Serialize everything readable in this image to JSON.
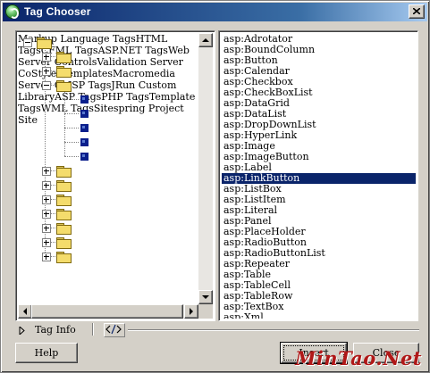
{
  "window": {
    "title": "Tag Chooser"
  },
  "tree": {
    "root": "Markup Language Tags",
    "folders_before": [
      "HTML Tags",
      "CFML Tags"
    ],
    "aspnet": {
      "label": "ASP.NET Tags",
      "children": [
        "Web Server Controls",
        "Validation Server Co",
        "Styles",
        "Templates",
        "Macromedia Server Co"
      ],
      "selected_child": "Web Server Controls"
    },
    "folders_after": [
      "JSP Tags",
      "JRun Custom Library",
      "ASP Tags",
      "PHP Tags",
      "Template Tags",
      "WML Tags",
      "Sitespring Project Site"
    ]
  },
  "list": {
    "items": [
      "asp:Adrotator",
      "asp:BoundColumn",
      "asp:Button",
      "asp:Calendar",
      "asp:Checkbox",
      "asp:CheckBoxList",
      "asp:DataGrid",
      "asp:DataList",
      "asp:DropDownList",
      "asp:HyperLink",
      "asp:Image",
      "asp:ImageButton",
      "asp:Label",
      "asp:LinkButton",
      "asp:ListBox",
      "asp:ListItem",
      "asp:Literal",
      "asp:Panel",
      "asp:PlaceHolder",
      "asp:RadioButton",
      "asp:RadioButtonList",
      "asp:Repeater",
      "asp:Table",
      "asp:TableCell",
      "asp:TableRow",
      "asp:TextBox",
      "asp:Xml"
    ],
    "selected": "asp:LinkButton"
  },
  "tag_info": {
    "label": "Tag Info"
  },
  "buttons": {
    "help": "Help",
    "insert": "Insert",
    "close": "Close"
  },
  "watermark": "MinTao.Net",
  "colors": {
    "selection": "#0a246a",
    "titlebar": "#0a246a",
    "watermark": "#b01818"
  }
}
